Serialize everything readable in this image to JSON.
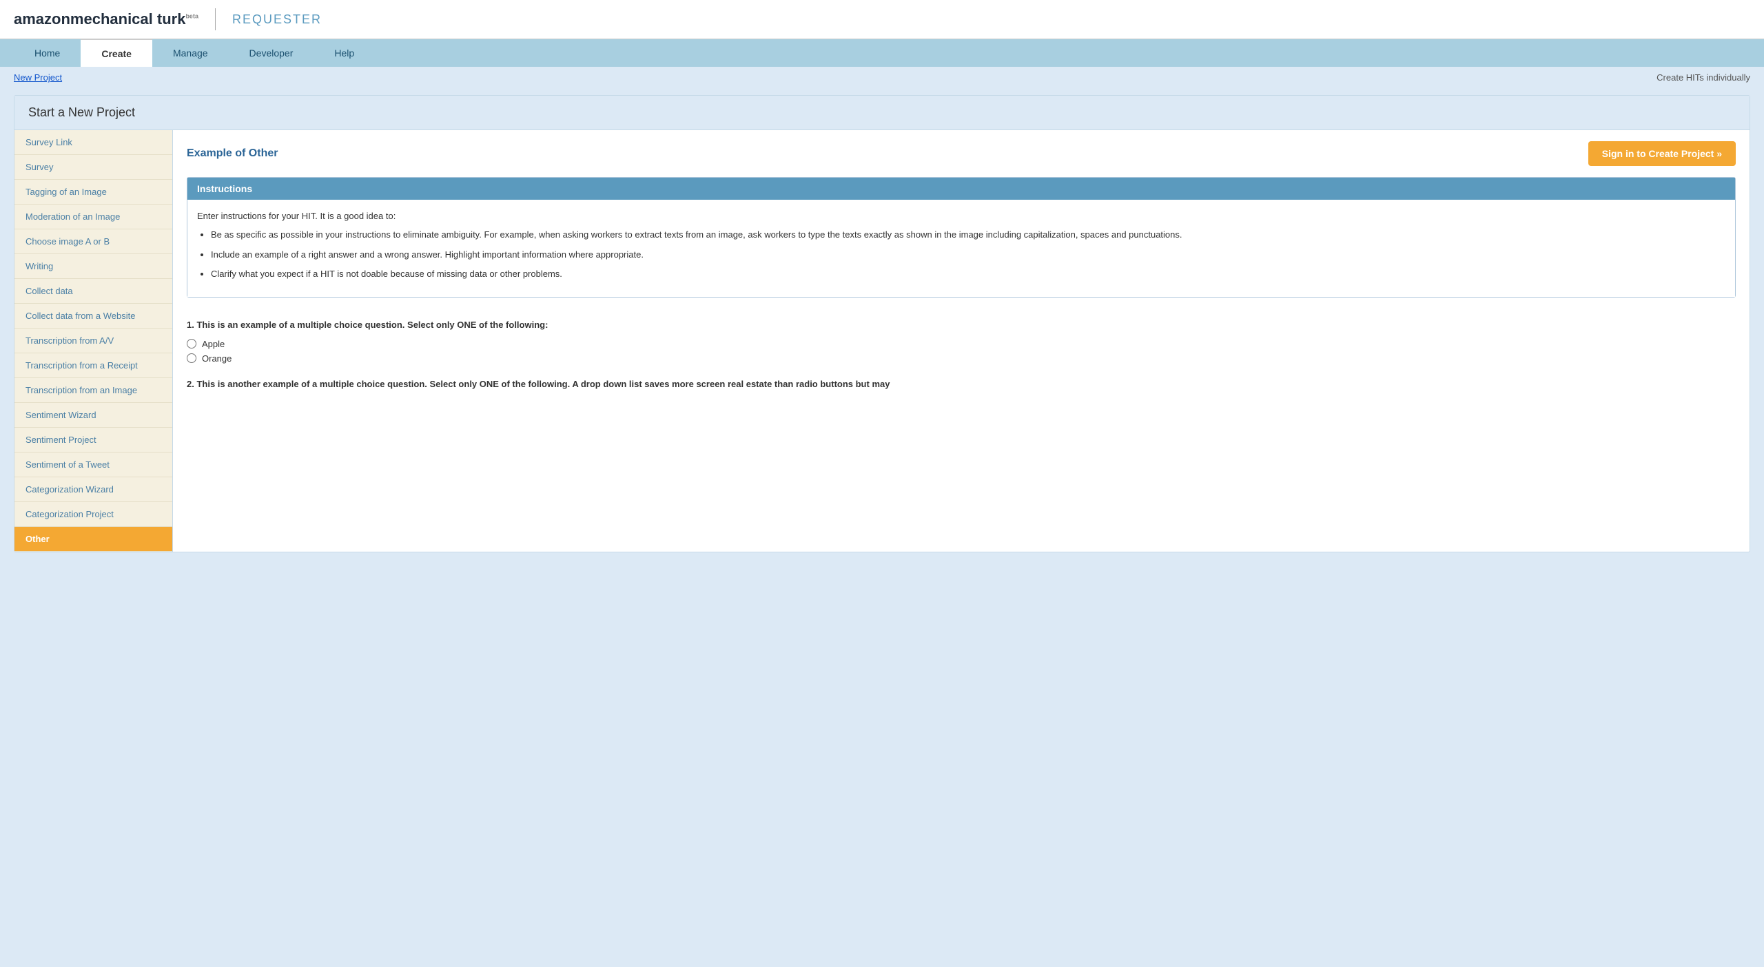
{
  "header": {
    "logo_amazon": "amazon",
    "logo_mturk": "mechanical turk",
    "logo_beta": "beta",
    "requester_label": "REQUESTER"
  },
  "nav": {
    "items": [
      {
        "id": "home",
        "label": "Home",
        "active": false
      },
      {
        "id": "create",
        "label": "Create",
        "active": true
      },
      {
        "id": "manage",
        "label": "Manage",
        "active": false
      },
      {
        "id": "developer",
        "label": "Developer",
        "active": false
      },
      {
        "id": "help",
        "label": "Help",
        "active": false
      }
    ]
  },
  "breadcrumb": {
    "link_text": "New Project",
    "secondary_link": "Create HITs individually"
  },
  "project": {
    "title": "Start a New Project"
  },
  "sidebar": {
    "items": [
      {
        "id": "survey-link",
        "label": "Survey Link",
        "active": false
      },
      {
        "id": "survey",
        "label": "Survey",
        "active": false
      },
      {
        "id": "tagging-image",
        "label": "Tagging of an Image",
        "active": false
      },
      {
        "id": "moderation-image",
        "label": "Moderation of an Image",
        "active": false
      },
      {
        "id": "choose-image",
        "label": "Choose image A or B",
        "active": false
      },
      {
        "id": "writing",
        "label": "Writing",
        "active": false
      },
      {
        "id": "collect-data",
        "label": "Collect data",
        "active": false
      },
      {
        "id": "collect-data-website",
        "label": "Collect data from a Website",
        "active": false
      },
      {
        "id": "transcription-av",
        "label": "Transcription from A/V",
        "active": false
      },
      {
        "id": "transcription-receipt",
        "label": "Transcription from a Receipt",
        "active": false
      },
      {
        "id": "transcription-image",
        "label": "Transcription from an Image",
        "active": false
      },
      {
        "id": "sentiment-wizard",
        "label": "Sentiment Wizard",
        "active": false
      },
      {
        "id": "sentiment-project",
        "label": "Sentiment Project",
        "active": false
      },
      {
        "id": "sentiment-tweet",
        "label": "Sentiment of a Tweet",
        "active": false
      },
      {
        "id": "categorization-wizard",
        "label": "Categorization Wizard",
        "active": false
      },
      {
        "id": "categorization-project",
        "label": "Categorization Project",
        "active": false
      },
      {
        "id": "other",
        "label": "Other",
        "active": true
      }
    ]
  },
  "panel": {
    "title": "Example of Other",
    "sign_in_btn": "Sign in to Create Project »"
  },
  "instructions": {
    "header": "Instructions",
    "intro": "Enter instructions for your HIT. It is a good idea to:",
    "bullets": [
      "Be as specific as possible in your instructions to eliminate ambiguity. For example, when asking workers to extract texts from an image, ask workers to type the texts exactly as shown in the image including capitalization, spaces and punctuations.",
      "Include an example of a right answer and a wrong answer. Highlight important information where appropriate.",
      "Clarify what you expect if a HIT is not doable because of missing data or other problems."
    ]
  },
  "questions": [
    {
      "id": "q1",
      "text": "1. This is an example of a multiple choice question. Select only ONE of the following:",
      "options": [
        "Apple",
        "Orange"
      ]
    },
    {
      "id": "q2",
      "text": "2. This is another example of a multiple choice question. Select only ONE of the following. A drop down list saves more screen real estate than radio buttons but may"
    }
  ]
}
